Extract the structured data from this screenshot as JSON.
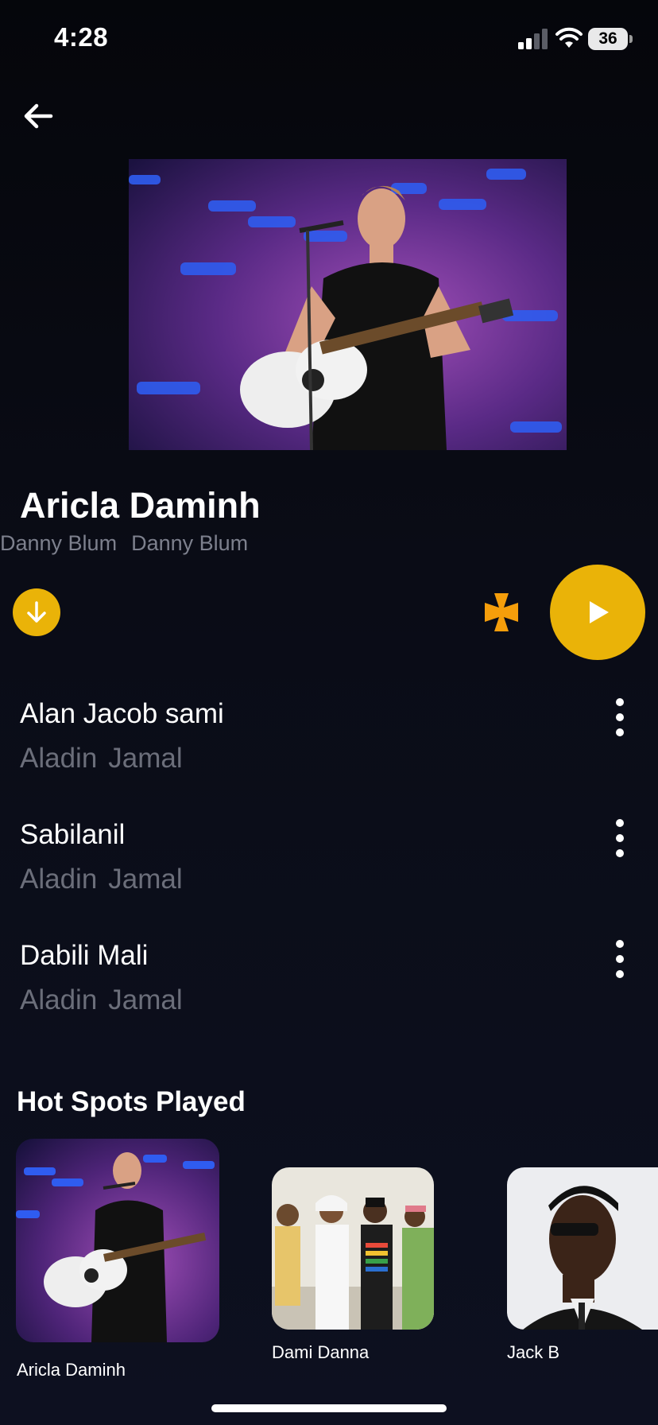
{
  "status_bar": {
    "time": "4:28",
    "battery": "36"
  },
  "album": {
    "title": "Aricla Daminh",
    "artists": [
      "Danny Blum",
      "Danny Blum"
    ]
  },
  "colors": {
    "accent": "#eab308",
    "shuffle": "#f59e0b",
    "muted_text": "#6b6e7a"
  },
  "icons": {
    "back": "arrow-left-icon",
    "download": "arrow-down-icon",
    "shuffle": "cross-icon",
    "play": "play-icon",
    "more": "more-vertical-icon"
  },
  "tracks": [
    {
      "title": "Alan Jacob sami",
      "artists": [
        "Aladin",
        "Jamal"
      ]
    },
    {
      "title": "Sabilanil",
      "artists": [
        "Aladin",
        "Jamal"
      ]
    },
    {
      "title": "Dabili Mali",
      "artists": [
        "Aladin",
        "Jamal"
      ]
    }
  ],
  "hot_spots": {
    "title": "Hot Spots Played",
    "items": [
      {
        "label": "Aricla Daminh"
      },
      {
        "label": "Dami Danna"
      },
      {
        "label": "Jack B"
      }
    ]
  }
}
